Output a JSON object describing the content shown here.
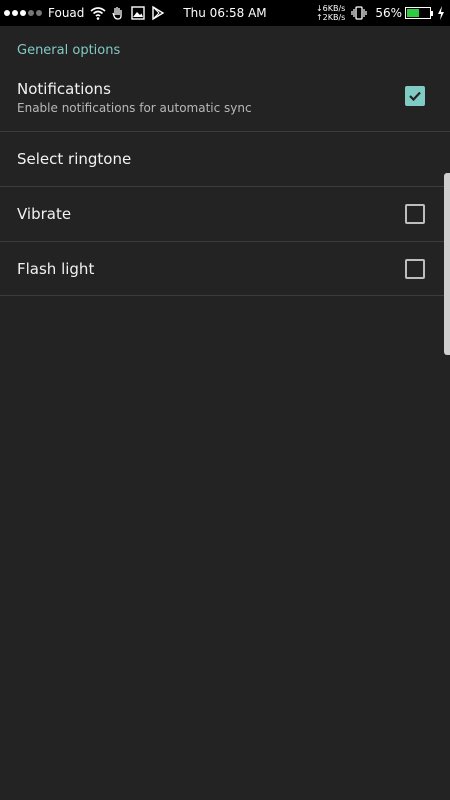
{
  "status_bar": {
    "carrier": "Fouad",
    "time": "Thu 06:58 AM",
    "download_speed": "↓6KB/s",
    "upload_speed": "↑2KB/s",
    "battery_percent": "56%",
    "battery_level": 0.56,
    "accent_color": "#2ecc40"
  },
  "settings": {
    "section_title": "General options",
    "accent_color": "#80cbc4",
    "items": [
      {
        "title": "Notifications",
        "subtitle": "Enable notifications for automatic sync",
        "checkbox": true,
        "checked": true
      },
      {
        "title": "Select ringtone",
        "checkbox": false
      },
      {
        "title": "Vibrate",
        "checkbox": true,
        "checked": false
      },
      {
        "title": "Flash light",
        "checkbox": true,
        "checked": false
      }
    ]
  }
}
